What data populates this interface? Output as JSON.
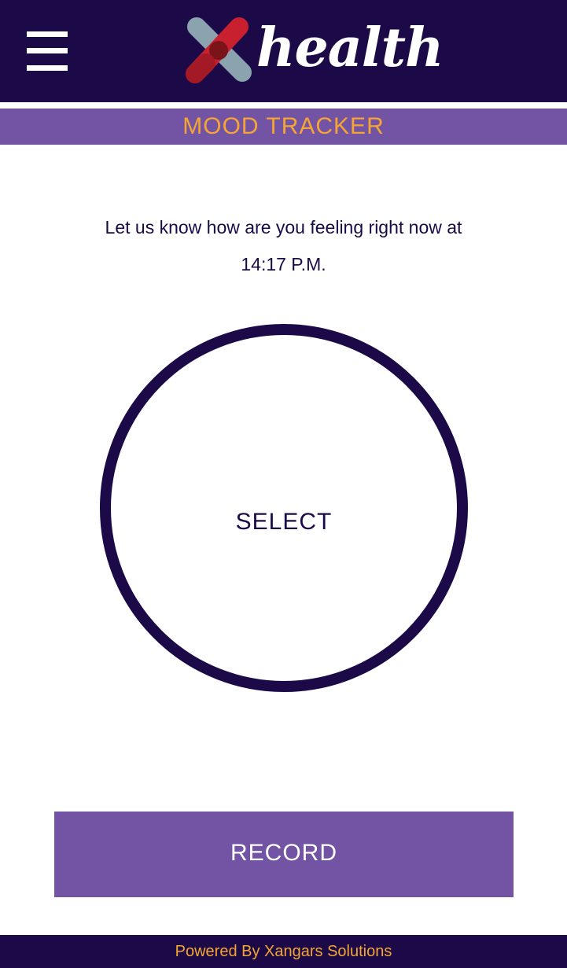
{
  "header": {
    "menu_icon": "hamburger-menu-icon",
    "logo": {
      "text": "health",
      "mark_icon": "x-cross-logo-icon",
      "colors": {
        "red": "#c8202f",
        "steel": "#8ba3ae",
        "overlap": "#7a1418"
      }
    }
  },
  "page": {
    "title": "MOOD TRACKER"
  },
  "prompt": {
    "line1": "Let us know how are you feeling right now at",
    "time": "14:17 P.M."
  },
  "mood_selector": {
    "label": "SELECT"
  },
  "actions": {
    "record_label": "RECORD"
  },
  "footer": {
    "text": "Powered By Xangars Solutions"
  },
  "colors": {
    "primary_dark": "#1b0a47",
    "accent_purple": "#7353a4",
    "accent_orange": "#f5a533",
    "background": "#ffffff"
  }
}
